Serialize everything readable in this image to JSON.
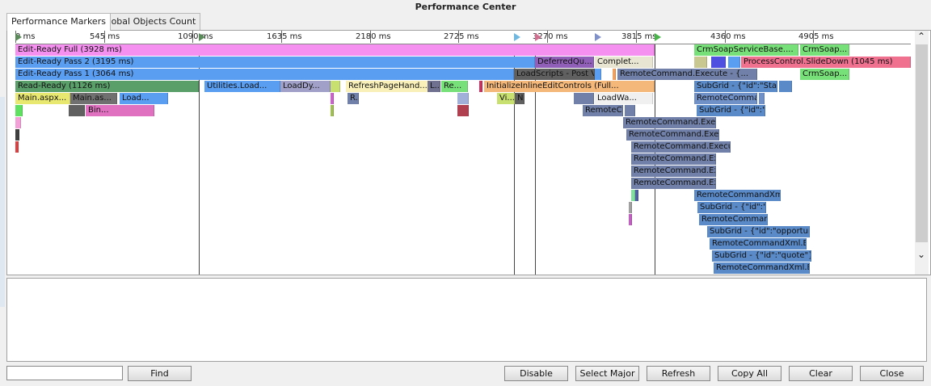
{
  "window": {
    "title": "Performance Center"
  },
  "tabs": [
    {
      "label": "Performance Markers",
      "active": true
    },
    {
      "label": "Global Objects Count",
      "active": false
    }
  ],
  "ruler": {
    "ticks": [
      "0 ms",
      "545 ms",
      "1090 ms",
      "1635 ms",
      "2180 ms",
      "2725 ms",
      "3270 ms",
      "3815 ms",
      "4360 ms",
      "4905 ms"
    ],
    "markers": [
      {
        "color": "#5a8a5a",
        "ms": 0
      },
      {
        "color": "#5a8a5a",
        "ms": 1126
      },
      {
        "color": "#70b8e0",
        "ms": 3064
      },
      {
        "color": "#d07090",
        "ms": 3195
      },
      {
        "color": "#8090c8",
        "ms": 3560
      },
      {
        "color": "#4bb34b",
        "ms": 3928
      }
    ]
  },
  "timeline": {
    "lane_height": 15,
    "scale_max_ms": 5505,
    "vlines_ms": [
      1126,
      3064,
      3195,
      3928
    ],
    "bars": [
      {
        "lane": 0,
        "start": 0,
        "end": 3928,
        "label": "Edit-Ready Full (3928 ms)",
        "color": "#f690f0"
      },
      {
        "lane": 0,
        "start": 4175,
        "end": 4815,
        "label": "CrmSoapServiceBase....",
        "color": "#78e078"
      },
      {
        "lane": 0,
        "start": 4825,
        "end": 5130,
        "label": "CrmSoap...",
        "color": "#78e078"
      },
      {
        "lane": 1,
        "start": 0,
        "end": 3195,
        "label": "Edit-Ready Pass 2 (3195 ms)",
        "color": "#5a9ef2"
      },
      {
        "lane": 1,
        "start": 3195,
        "end": 3560,
        "label": "DeferredQu...",
        "color": "#9060b8"
      },
      {
        "lane": 1,
        "start": 3560,
        "end": 3920,
        "label": "Complet...",
        "color": "#e8e6d2"
      },
      {
        "lane": 1,
        "start": 4175,
        "end": 4255,
        "label": "",
        "color": "#c8c890"
      },
      {
        "lane": 1,
        "start": 4280,
        "end": 4370,
        "label": "",
        "color": "#5050e0"
      },
      {
        "lane": 1,
        "start": 4380,
        "end": 4455,
        "label": "",
        "color": "#5a9ef2"
      },
      {
        "lane": 1,
        "start": 4460,
        "end": 5525,
        "label": "ProcessControl.SlideDown (1045 ms)",
        "color": "#f07090"
      },
      {
        "lane": 2,
        "start": 0,
        "end": 3064,
        "label": "Edit-Ready Pass 1 (3064 ms)",
        "color": "#5a9ef2"
      },
      {
        "lane": 2,
        "start": 3064,
        "end": 3560,
        "label": "LoadScripts - Post V...",
        "color": "#606060"
      },
      {
        "lane": 2,
        "start": 3560,
        "end": 3600,
        "label": "",
        "color": "#5a9ef2"
      },
      {
        "lane": 2,
        "start": 3670,
        "end": 3690,
        "label": "",
        "color": "#f0a060"
      },
      {
        "lane": 2,
        "start": 3700,
        "end": 4560,
        "label": "RemoteCommand.Execute - {...",
        "color": "#7080a8"
      },
      {
        "lane": 2,
        "start": 4825,
        "end": 5130,
        "label": "CrmSoap...",
        "color": "#78e078"
      },
      {
        "lane": 3,
        "start": 0,
        "end": 1126,
        "label": "Read-Ready (1126 ms)",
        "color": "#5a9e6a"
      },
      {
        "lane": 3,
        "start": 1165,
        "end": 1630,
        "label": "Utilities.Load...",
        "color": "#5a9ef2"
      },
      {
        "lane": 3,
        "start": 1630,
        "end": 1940,
        "label": "LoadDy...",
        "color": "#a0a0c8"
      },
      {
        "lane": 3,
        "start": 1940,
        "end": 2000,
        "label": "",
        "color": "#c8e070"
      },
      {
        "lane": 3,
        "start": 2030,
        "end": 2535,
        "label": "RefreshPageHand...",
        "color": "#f8f0b8"
      },
      {
        "lane": 3,
        "start": 2535,
        "end": 2615,
        "label": "L...",
        "color": "#707090"
      },
      {
        "lane": 3,
        "start": 2620,
        "end": 2785,
        "label": "Re...",
        "color": "#78e078"
      },
      {
        "lane": 3,
        "start": 2850,
        "end": 2865,
        "label": "",
        "color": "#d03060"
      },
      {
        "lane": 3,
        "start": 2880,
        "end": 3928,
        "label": "InitializeInlineEditControls (Full...",
        "color": "#f4b87a"
      },
      {
        "lane": 3,
        "start": 4175,
        "end": 4685,
        "label": "SubGrid - {\"id\":\"Stakehold...",
        "color": "#5a8ac8"
      },
      {
        "lane": 3,
        "start": 4695,
        "end": 4775,
        "label": "",
        "color": "#5a8ac8"
      },
      {
        "lane": 4,
        "start": 0,
        "end": 340,
        "label": "Main.aspx...",
        "color": "#e8e870"
      },
      {
        "lane": 4,
        "start": 340,
        "end": 630,
        "label": "Main.as...",
        "color": "#707070"
      },
      {
        "lane": 4,
        "start": 640,
        "end": 940,
        "label": "Load...",
        "color": "#5a9ef2"
      },
      {
        "lane": 4,
        "start": 1940,
        "end": 1955,
        "label": "",
        "color": "#d060d0"
      },
      {
        "lane": 4,
        "start": 2040,
        "end": 2110,
        "label": "R...",
        "color": "#7080a8"
      },
      {
        "lane": 4,
        "start": 2720,
        "end": 2790,
        "label": "",
        "color": "#a0b0d8"
      },
      {
        "lane": 4,
        "start": 2960,
        "end": 3070,
        "label": "Vi...",
        "color": "#c8e070"
      },
      {
        "lane": 4,
        "start": 3070,
        "end": 3130,
        "label": "N...",
        "color": "#606060"
      },
      {
        "lane": 4,
        "start": 3435,
        "end": 3560,
        "label": "",
        "color": "#7080a8"
      },
      {
        "lane": 4,
        "start": 3560,
        "end": 3920,
        "label": "LoadWa...",
        "color": "#f0f0f0"
      },
      {
        "lane": 4,
        "start": 4175,
        "end": 4565,
        "label": "RemoteCommandXml.Exec...",
        "color": "#7090c8"
      },
      {
        "lane": 4,
        "start": 4570,
        "end": 4605,
        "label": "",
        "color": "#7090c8"
      },
      {
        "lane": 5,
        "start": 0,
        "end": 45,
        "label": "",
        "color": "#60e060"
      },
      {
        "lane": 5,
        "start": 330,
        "end": 430,
        "label": "",
        "color": "#606060"
      },
      {
        "lane": 5,
        "start": 430,
        "end": 850,
        "label": "Bin...",
        "color": "#e070c0"
      },
      {
        "lane": 5,
        "start": 1940,
        "end": 1955,
        "label": "",
        "color": "#a0c050"
      },
      {
        "lane": 5,
        "start": 2720,
        "end": 2790,
        "label": "",
        "color": "#b04050"
      },
      {
        "lane": 5,
        "start": 3490,
        "end": 3740,
        "label": "RemoteC...",
        "color": "#7080a8"
      },
      {
        "lane": 5,
        "start": 3745,
        "end": 3810,
        "label": "",
        "color": "#7080a8"
      },
      {
        "lane": 5,
        "start": 4190,
        "end": 4610,
        "label": "SubGrid - {\"id\":\"Pursuit_Te...",
        "color": "#5a8ac8"
      },
      {
        "lane": 6,
        "start": 0,
        "end": 35,
        "label": "",
        "color": "#f4a0d8"
      },
      {
        "lane": 6,
        "start": 3735,
        "end": 4305,
        "label": "RemoteCommand.Execute - ...",
        "color": "#7080a8"
      },
      {
        "lane": 7,
        "start": 0,
        "end": 25,
        "label": "",
        "color": "#404040"
      },
      {
        "lane": 7,
        "start": 3755,
        "end": 4325,
        "label": "RemoteCommand.Execute -...",
        "color": "#7080a8"
      },
      {
        "lane": 8,
        "start": 0,
        "end": 5,
        "label": "",
        "color": "#e04040"
      },
      {
        "lane": 8,
        "start": 3785,
        "end": 4395,
        "label": "RemoteCommand.Execute - {\"IsA...",
        "color": "#7080a8"
      },
      {
        "lane": 9,
        "start": 3785,
        "end": 4305,
        "label": "RemoteCommand.Execute ...",
        "color": "#7080a8"
      },
      {
        "lane": 10,
        "start": 3785,
        "end": 4305,
        "label": "RemoteCommand.Execute ...",
        "color": "#7080a8"
      },
      {
        "lane": 11,
        "start": 3785,
        "end": 4305,
        "label": "RemoteCommand.Execute...",
        "color": "#7080a8"
      },
      {
        "lane": 12,
        "start": 3785,
        "end": 3810,
        "label": "",
        "color": "#80e0a0"
      },
      {
        "lane": 12,
        "start": 3810,
        "end": 3830,
        "label": "",
        "color": "#5060a0"
      },
      {
        "lane": 12,
        "start": 4175,
        "end": 4705,
        "label": "RemoteCommandXml.Execut...",
        "color": "#5a8ac8"
      },
      {
        "lane": 13,
        "start": 3770,
        "end": 3780,
        "label": "",
        "color": "#a0a0a0"
      },
      {
        "lane": 13,
        "start": 4195,
        "end": 4615,
        "label": "SubGrid - {\"id\":\"C...",
        "color": "#5a8ac8"
      },
      {
        "lane": 14,
        "start": 3770,
        "end": 3780,
        "label": "",
        "color": "#c060c0"
      },
      {
        "lane": 14,
        "start": 4205,
        "end": 4625,
        "label": "RemoteCommandXml...",
        "color": "#5a8ac8"
      },
      {
        "lane": 15,
        "start": 4255,
        "end": 4885,
        "label": "SubGrid - {\"id\":\"opportuni...",
        "color": "#5a8ac8"
      },
      {
        "lane": 16,
        "start": 4270,
        "end": 4865,
        "label": "RemoteCommandXml.Execut...",
        "color": "#5a8ac8"
      },
      {
        "lane": 17,
        "start": 4285,
        "end": 4895,
        "label": "SubGrid - {\"id\":\"quote\"} ...",
        "color": "#5a8ac8"
      },
      {
        "lane": 18,
        "start": 4295,
        "end": 4885,
        "label": "RemoteCommandXml.Execute...",
        "color": "#5a8ac8"
      }
    ]
  },
  "scrollbar": {
    "up_icon": "chevron-up",
    "down_icon": "chevron-down"
  },
  "bottom": {
    "find_input_value": "",
    "find_label": "Find",
    "disable_label": "Disable",
    "select_major_label": "Select Major",
    "refresh_label": "Refresh",
    "copy_all_label": "Copy All",
    "clear_label": "Clear",
    "close_label": "Close"
  }
}
